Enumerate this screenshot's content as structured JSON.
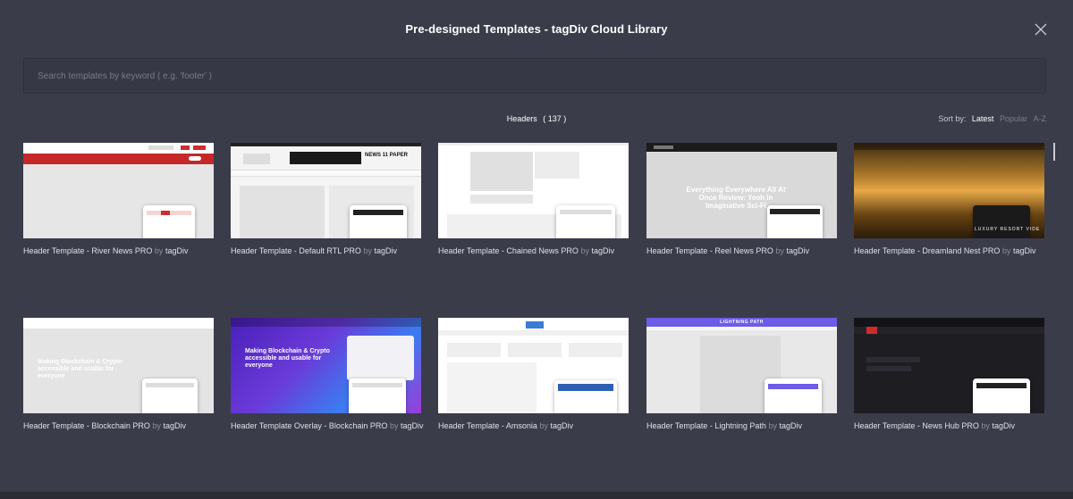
{
  "modal": {
    "title": "Pre-designed Templates - tagDiv Cloud Library",
    "close_icon": "close-icon"
  },
  "search": {
    "placeholder": "Search templates by keyword ( e.g. 'footer' )",
    "value": ""
  },
  "category": {
    "label": "Headers",
    "count": "( 137 )"
  },
  "sort": {
    "label": "Sort by:",
    "options": [
      "Latest",
      "Popular",
      "A-Z"
    ],
    "active": "Latest"
  },
  "templates": [
    {
      "name": "Header Template - River News PRO",
      "by": "by",
      "author": "tagDiv",
      "thumb_text": ""
    },
    {
      "name": "Header Template - Default RTL PRO",
      "by": "by",
      "author": "tagDiv",
      "thumb_text": "NEWS 11 PAPER"
    },
    {
      "name": "Header Template - Chained News PRO",
      "by": "by",
      "author": "tagDiv",
      "thumb_text": ""
    },
    {
      "name": "Header Template - Reel News PRO",
      "by": "by",
      "author": "tagDiv",
      "thumb_text": "Everything Everywhere All At Once Review: Yeoh In Imaginative Sci-Fi"
    },
    {
      "name": "Header Template - Dreamland Nest PRO",
      "by": "by",
      "author": "tagDiv",
      "thumb_text": "LUXURY RESORT VIDE"
    },
    {
      "name": "Header Template - Blockchain PRO",
      "by": "by",
      "author": "tagDiv",
      "thumb_text": "Making Blockchain & Crypto accessible and usable for everyone"
    },
    {
      "name": "Header Template Overlay - Blockchain PRO",
      "by": "by",
      "author": "tagDiv",
      "thumb_text": "Making Blockchain & Crypto accessible and usable for everyone"
    },
    {
      "name": "Header Template - Amsonia",
      "by": "by",
      "author": "tagDiv",
      "thumb_text": ""
    },
    {
      "name": "Header Template - Lightning Path",
      "by": "by",
      "author": "tagDiv",
      "thumb_text": "LIGHTNING PATH"
    },
    {
      "name": "Header Template - News Hub PRO",
      "by": "by",
      "author": "tagDiv",
      "thumb_text": ""
    }
  ],
  "colors": {
    "background": "#3a3c49",
    "accent_red": "#d12c2c",
    "accent_purple": "#6c5ce7",
    "dark_thumb": "#1d1d22"
  }
}
